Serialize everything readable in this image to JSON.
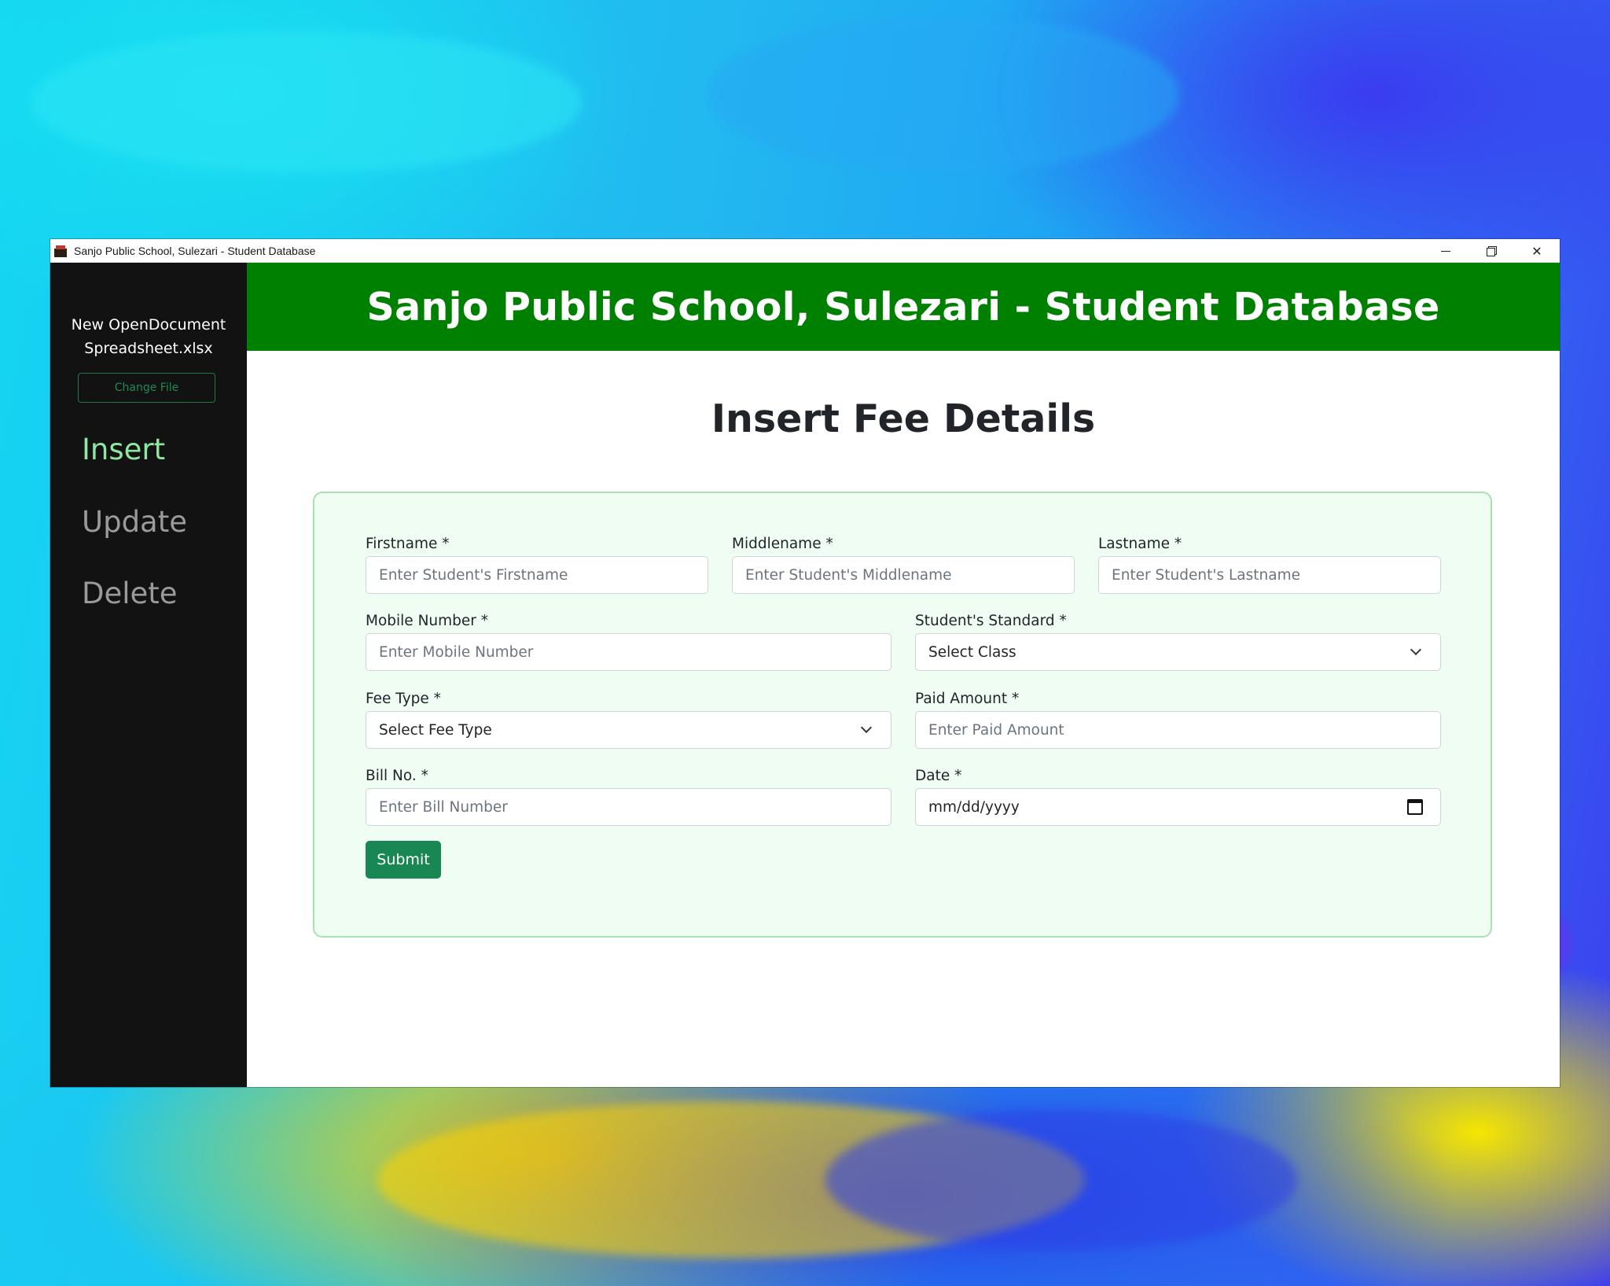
{
  "window": {
    "title": "Sanjo Public School, Sulezari - Student Database",
    "controls": {
      "minimize": "",
      "restore": "",
      "close": "✕"
    }
  },
  "sidebar": {
    "file_name_line1": "New OpenDocument",
    "file_name_line2": "Spreadsheet.xlsx",
    "change_file_label": "Change File",
    "nav": {
      "insert": "Insert",
      "update": "Update",
      "delete": "Delete"
    },
    "active_item": "Insert"
  },
  "header": {
    "title": "Sanjo Public School, Sulezari - Student Database"
  },
  "page": {
    "title": "Insert Fee Details"
  },
  "form": {
    "firstname": {
      "label": "Firstname *",
      "placeholder": "Enter Student's Firstname"
    },
    "middlename": {
      "label": "Middlename *",
      "placeholder": "Enter Student's Middlename"
    },
    "lastname": {
      "label": "Lastname *",
      "placeholder": "Enter Student's Lastname"
    },
    "mobile": {
      "label": "Mobile Number *",
      "placeholder": "Enter Mobile Number"
    },
    "standard": {
      "label": "Student's Standard *",
      "selected": "Select Class"
    },
    "fee_type": {
      "label": "Fee Type *",
      "selected": "Select Fee Type"
    },
    "paid_amount": {
      "label": "Paid Amount *",
      "placeholder": "Enter Paid Amount"
    },
    "bill_no": {
      "label": "Bill No. *",
      "placeholder": "Enter Bill Number"
    },
    "date": {
      "label": "Date *",
      "placeholder": "mm/dd/yyyy"
    },
    "submit_label": "Submit"
  },
  "colors": {
    "header_green": "#008000",
    "sidebar_bg": "#121212",
    "active_nav": "#8fe6a1",
    "submit_green": "#198754",
    "card_bg": "#f0fdf2",
    "card_border": "#a8e2b0"
  }
}
